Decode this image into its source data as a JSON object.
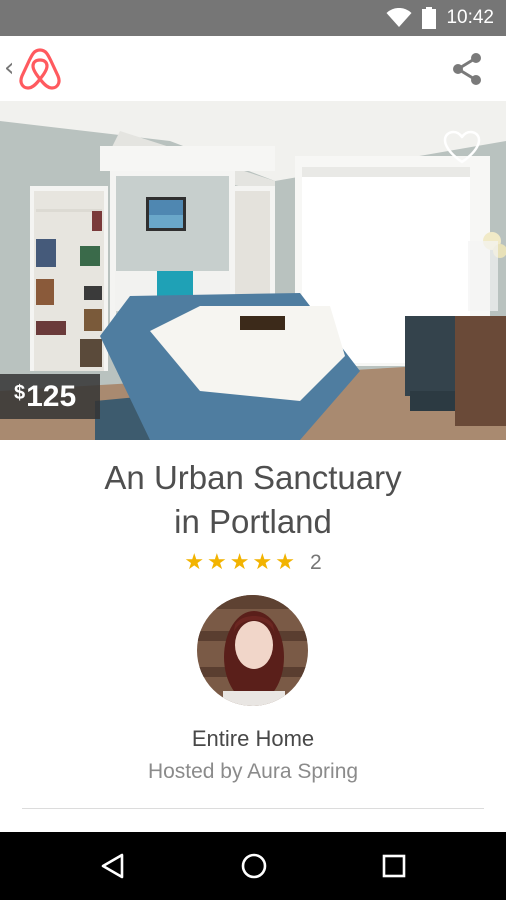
{
  "status_bar": {
    "time": "10:42",
    "icons": [
      "wifi-icon",
      "battery-icon"
    ]
  },
  "toolbar": {
    "back_icon": "chevron-left-icon",
    "logo": "airbnb-logo",
    "share_icon": "share-icon",
    "brand_color": "#FF5A5F"
  },
  "listing": {
    "currency": "$",
    "price": "125",
    "title_line1": "An Urban Sanctuary",
    "title_line2": "in Portland",
    "rating": 5,
    "stars": [
      "★",
      "★",
      "★",
      "★",
      "★"
    ],
    "review_count": "2",
    "room_type": "Entire Home",
    "host_line": "Hosted by Aura Spring",
    "save_icon": "heart-icon"
  },
  "colors": {
    "star": "#F2B300",
    "title": "#4F4F4F",
    "status_bar": "#767676"
  },
  "nav_bar": {
    "buttons": [
      "back-triangle-icon",
      "home-circle-icon",
      "recents-square-icon"
    ]
  }
}
